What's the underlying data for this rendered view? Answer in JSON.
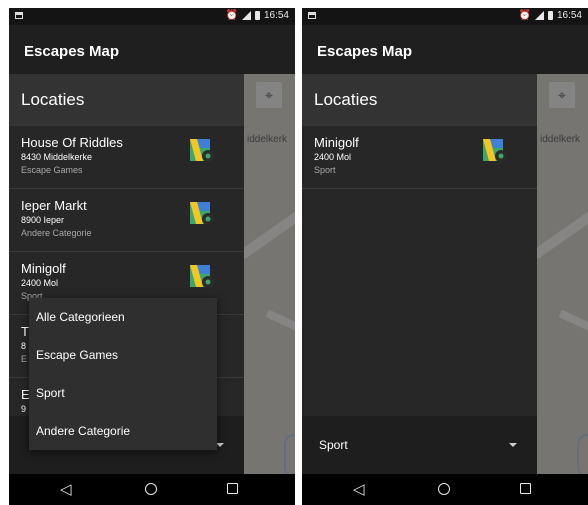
{
  "screens": [
    {
      "status": {
        "time": "16:54"
      },
      "app_title": "Escapes Map",
      "drawer_title": "Locaties",
      "map_place_label": "iddelkerk",
      "locations": [
        {
          "name": "House Of Riddles",
          "address": "8430 Middelkerke",
          "category": "Escape Games"
        },
        {
          "name": "Ieper Markt",
          "address": "8900 Ieper",
          "category": "Andere Categorie"
        },
        {
          "name": "Minigolf",
          "address": "2400 Mol",
          "category": "Sport"
        },
        {
          "name": "T",
          "address": "8",
          "category": "E"
        },
        {
          "name": "E",
          "address": "9",
          "category": ""
        }
      ],
      "filter_selected": "",
      "dropdown_options": [
        "Alle Categorieen",
        "Escape Games",
        "Sport",
        "Andere Categorie"
      ]
    },
    {
      "status": {
        "time": "16:54"
      },
      "app_title": "Escapes Map",
      "drawer_title": "Locaties",
      "map_place_label": "iddelkerk",
      "locations": [
        {
          "name": "Minigolf",
          "address": "2400 Mol",
          "category": "Sport"
        }
      ],
      "filter_selected": "Sport"
    }
  ],
  "icons": {
    "status_alarm": "alarm-icon",
    "status_signal": "signal-icon",
    "status_battery": "battery-icon",
    "map_locate": "my-location-icon",
    "list_map": "map-icon",
    "nav_back": "back-icon",
    "nav_home": "home-icon",
    "nav_recent": "recent-apps-icon"
  },
  "colors": {
    "appbar": "#1f1f1f",
    "drawer": "#272727",
    "drawer_header": "#333333",
    "map_icon_green": "#3aa76d",
    "map_icon_yellow": "#f3c623",
    "map_icon_blue": "#3f7fd6"
  }
}
